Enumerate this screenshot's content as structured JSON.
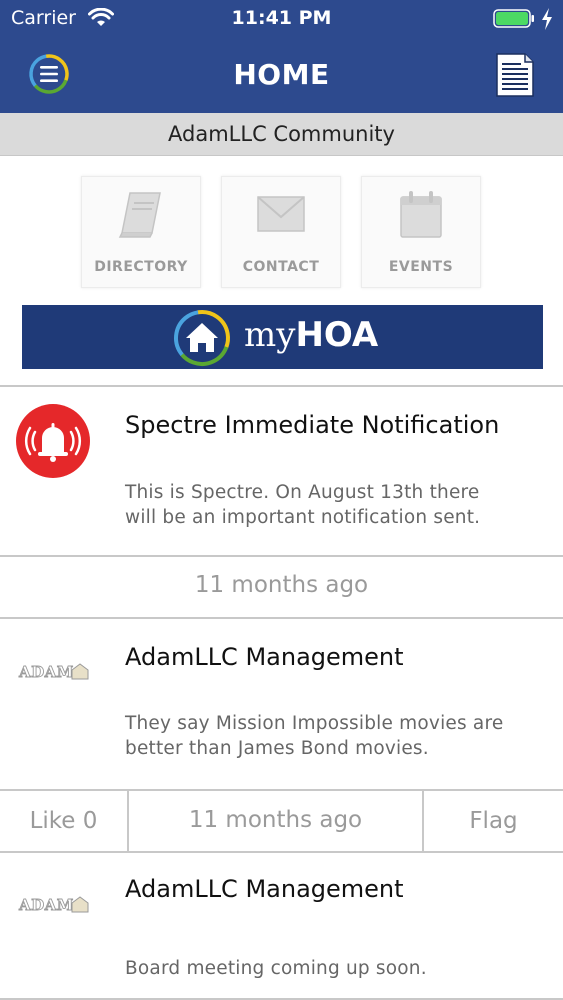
{
  "status_bar": {
    "carrier": "Carrier",
    "time": "11:41 PM"
  },
  "nav": {
    "title": "HOME",
    "menu_icon": "menu-icon",
    "right_icon": "document-icon"
  },
  "community": {
    "name": "AdamLLC Community"
  },
  "quick_links": [
    {
      "label": "DIRECTORY",
      "icon": "book-icon"
    },
    {
      "label": "CONTACT",
      "icon": "envelope-icon"
    },
    {
      "label": "EVENTS",
      "icon": "calendar-icon"
    }
  ],
  "banner": {
    "brand_prefix": "my",
    "brand_suffix": "HOA"
  },
  "posts": [
    {
      "author": "Spectre Immediate Notification",
      "icon": "alarm-bell-icon",
      "body_line1": "This is Spectre.  On August 13th there",
      "body_line2": "will be an important notification sent.",
      "time": "11 months ago"
    },
    {
      "author": "AdamLLC Management",
      "icon": "adam-logo",
      "body_line1": "They say Mission Impossible movies are",
      "body_line2": "better than James Bond movies.",
      "time": "11 months ago",
      "like_label": "Like 0",
      "flag_label": "Flag"
    },
    {
      "author": "AdamLLC Management",
      "icon": "adam-logo",
      "body_line1": "Board meeting coming up soon."
    }
  ],
  "colors": {
    "nav_bar": "#2d4a8e",
    "banner": "#1f3a78",
    "alert_red": "#e5282a",
    "battery_green": "#4cd964"
  }
}
